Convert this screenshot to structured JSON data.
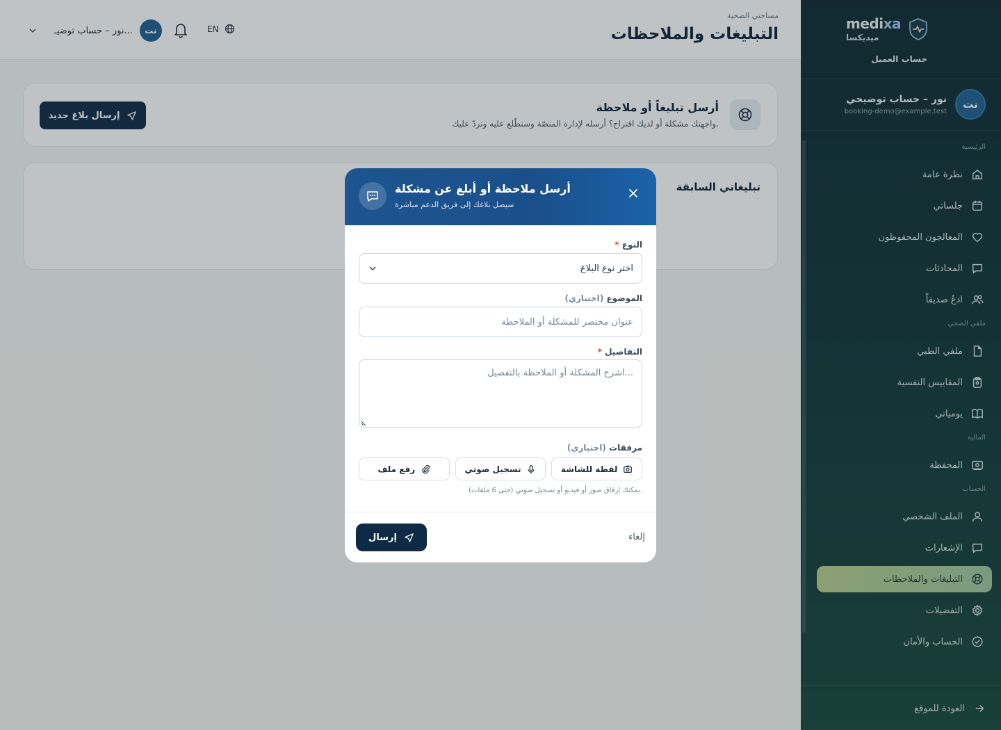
{
  "sidebar": {
    "brand_en": "medixa",
    "brand_ar": "ميديكسا",
    "account_type": "حساب العميل",
    "user": {
      "initials": "نت",
      "name": "نور – حساب توضيحي",
      "email": "booking-demo@example.test"
    },
    "sections": {
      "main": "الرئيسية",
      "health_file": "ملفي الصحي",
      "finance": "المالية",
      "account": "الحساب"
    },
    "items": [
      {
        "label": "نظرة عامة",
        "icon": "home-icon"
      },
      {
        "label": "جلساتي",
        "icon": "calendar-icon"
      },
      {
        "label": "المعالجون المحفوظون",
        "icon": "heart-icon"
      },
      {
        "label": "المحادثات",
        "icon": "chat-icon"
      },
      {
        "label": "ادعُ صديقاً",
        "icon": "users-icon"
      },
      {
        "label": "ملفي الطبي",
        "icon": "file-icon"
      },
      {
        "label": "المقاييس النفسية",
        "icon": "clipboard-icon"
      },
      {
        "label": "يومياتي",
        "icon": "book-icon"
      },
      {
        "label": "المحفظة",
        "icon": "wallet-icon"
      },
      {
        "label": "الملف الشخصي",
        "icon": "user-icon"
      },
      {
        "label": "الإشعارات",
        "icon": "bell-chat-icon"
      },
      {
        "label": "التبليغات والملاحظات",
        "icon": "lifebuoy-icon"
      },
      {
        "label": "التفضيلات",
        "icon": "gear-icon"
      },
      {
        "label": "الحساب والأمان",
        "icon": "shield-check-icon"
      }
    ],
    "back_to_site": "العودة للموقع"
  },
  "topbar": {
    "breadcrumb": "مساحتي الصحية",
    "title": "التبليغات والملاحظات",
    "language": "EN",
    "user_chip_initials": "نت",
    "user_chip_name": "نور – حساب توضيـ..."
  },
  "report_card": {
    "title": "أرسل تبليغاً أو ملاحظة",
    "description": "واجهتك مشكلة أو لديك اقتراح؟ أرسله لإدارة المنصّة وسنطّلع عليه ونردّ عليك.",
    "button": "إرسال بلاغ جديد"
  },
  "previous_card": {
    "title": "تبليغاتي السابقة"
  },
  "modal": {
    "title": "أرسل ملاحظة أو أبلغ عن مشكلة",
    "subtitle": "سيصل بلاغك إلى فريق الدعم مباشرة",
    "type_label": "النوع",
    "type_placeholder": "اختر نوع البلاغ",
    "subject_label": "الموضوع",
    "optional": "(اختياري)",
    "subject_placeholder": "عنوان مختصر للمشكلة أو الملاحظة",
    "details_label": "التفاصيل",
    "details_placeholder": "اشرح المشكلة أو الملاحظة بالتفصيل...",
    "attachments_label": "مرفقات",
    "attach_screenshot": "لقطة للشاشة",
    "attach_voice": "تسجيل صوتي",
    "attach_file": "رفع ملف",
    "attach_hint": "يمكنك إرفاق صور أو فيديو أو تسجيل صوتي (حتى 6 ملفات).",
    "send": "إرسال",
    "cancel": "إلغاء"
  },
  "colors": {
    "sidebar_bg": "#0f2a33",
    "active_item": "#b7cf8d",
    "primary_dark": "#0e2a44",
    "modal_header": "#1d5590"
  }
}
